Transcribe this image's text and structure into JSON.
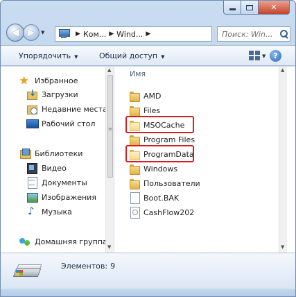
{
  "address": {
    "crumbs": [
      "Ком...",
      "Wind..."
    ],
    "search_placeholder": "Поиск: Win..."
  },
  "toolbar": {
    "organize_label": "Упорядочить",
    "share_label": "Общий доступ"
  },
  "sidebar": {
    "favorites_label": "Избранное",
    "favorites": [
      {
        "label": "Загрузки",
        "icon": "downloads-icon"
      },
      {
        "label": "Недавние места",
        "icon": "recent-places-icon"
      },
      {
        "label": "Рабочий стол",
        "icon": "desktop-icon"
      }
    ],
    "libraries_label": "Библиотеки",
    "libraries": [
      {
        "label": "Видео",
        "icon": "video-icon"
      },
      {
        "label": "Документы",
        "icon": "documents-icon"
      },
      {
        "label": "Изображения",
        "icon": "images-icon"
      },
      {
        "label": "Музыка",
        "icon": "music-icon"
      }
    ],
    "homegroup_label": "Домашняя группа"
  },
  "files": {
    "column_header": "Имя",
    "items": [
      {
        "name": "AMD",
        "type": "folder",
        "highlighted": false
      },
      {
        "name": "Files",
        "type": "folder",
        "highlighted": false
      },
      {
        "name": "MSOCache",
        "type": "folder-hidden",
        "highlighted": true
      },
      {
        "name": "Program Files",
        "type": "folder",
        "highlighted": false
      },
      {
        "name": "ProgramData",
        "type": "folder-hidden",
        "highlighted": true
      },
      {
        "name": "Windows",
        "type": "folder",
        "highlighted": false
      },
      {
        "name": "Пользователи",
        "type": "folder",
        "highlighted": false
      },
      {
        "name": "Boot.BAK",
        "type": "file",
        "highlighted": false
      },
      {
        "name": "CashFlow202",
        "type": "file",
        "highlighted": false
      }
    ]
  },
  "details": {
    "count_label": "Элементов:",
    "count_value": "9"
  },
  "colors": {
    "highlight": "#d31f23",
    "chrome": "#c9dcf0",
    "close_button": "#c7432a"
  }
}
